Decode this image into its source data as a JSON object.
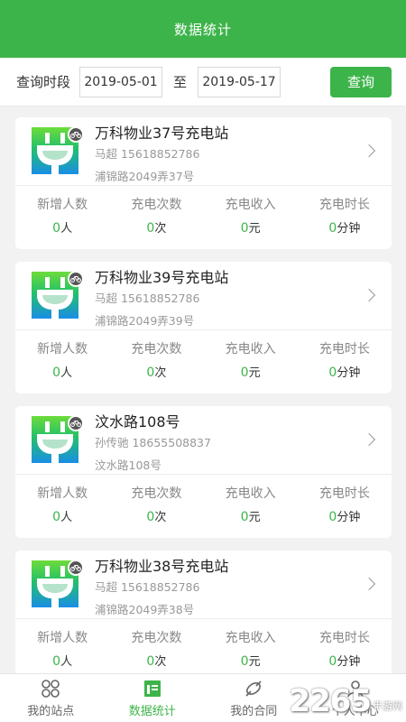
{
  "header": {
    "title": "数据统计"
  },
  "query": {
    "label": "查询时段",
    "start_date": "2019-05-01",
    "to_label": "至",
    "end_date": "2019-05-17",
    "button_label": "查询"
  },
  "stat_labels": [
    "新增人数",
    "充电次数",
    "充电收入",
    "充电时长"
  ],
  "stations": [
    {
      "name": "万科物业37号充电站",
      "contact": "马超 15618852786",
      "address": "浦锦路2049弄37号",
      "stats": [
        {
          "value": "0",
          "unit": "人"
        },
        {
          "value": "0",
          "unit": "次"
        },
        {
          "value": "0",
          "unit": "元"
        },
        {
          "value": "0",
          "unit": "分钟"
        }
      ]
    },
    {
      "name": "万科物业39号充电站",
      "contact": "马超 15618852786",
      "address": "浦锦路2049弄39号",
      "stats": [
        {
          "value": "0",
          "unit": "人"
        },
        {
          "value": "0",
          "unit": "次"
        },
        {
          "value": "0",
          "unit": "元"
        },
        {
          "value": "0",
          "unit": "分钟"
        }
      ]
    },
    {
      "name": "汶水路108号",
      "contact": "孙传驰 18655508837",
      "address": "汶水路108号",
      "stats": [
        {
          "value": "0",
          "unit": "人"
        },
        {
          "value": "0",
          "unit": "次"
        },
        {
          "value": "0",
          "unit": "元"
        },
        {
          "value": "0",
          "unit": "分钟"
        }
      ]
    },
    {
      "name": "万科物业38号充电站",
      "contact": "马超 15618852786",
      "address": "浦锦路2049弄38号",
      "stats": [
        {
          "value": "0",
          "unit": "人"
        },
        {
          "value": "0",
          "unit": "次"
        },
        {
          "value": "0",
          "unit": "元"
        },
        {
          "value": "0",
          "unit": "分钟"
        }
      ]
    }
  ],
  "tabbar": [
    {
      "label": "我的站点",
      "icon": "grid-icon"
    },
    {
      "label": "数据统计",
      "icon": "table-icon"
    },
    {
      "label": "我的合同",
      "icon": "contract-icon"
    },
    {
      "label": "个人中心",
      "icon": "person-icon"
    }
  ],
  "tabbar_active": 1,
  "colors": {
    "accent": "#3db44a",
    "background": "#f2f2f2"
  },
  "watermark": {
    "logo": "2265",
    "sub": "手游网"
  }
}
